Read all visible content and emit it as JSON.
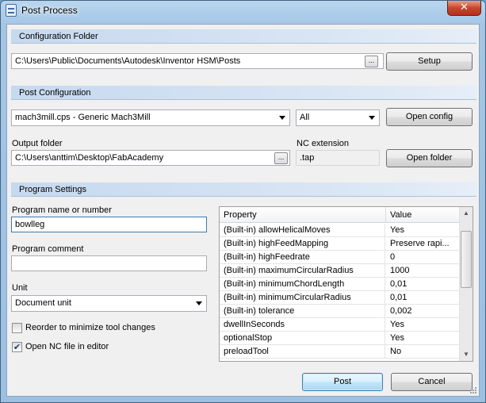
{
  "window": {
    "title": "Post Process",
    "close_symbol": "✕"
  },
  "config_folder": {
    "header": "Configuration Folder",
    "path": "C:\\Users\\Public\\Documents\\Autodesk\\Inventor HSM\\Posts",
    "browse_label": "...",
    "setup_label": "Setup"
  },
  "post_config": {
    "header": "Post Configuration",
    "post_selected": "mach3mill.cps - Generic Mach3Mill",
    "filter_selected": "All",
    "open_config_label": "Open config",
    "output_folder_label": "Output folder",
    "output_folder_path": "C:\\Users\\anttim\\Desktop\\FabAcademy",
    "browse_label": "...",
    "nc_extension_label": "NC extension",
    "nc_extension_value": ".tap",
    "open_folder_label": "Open folder"
  },
  "program_settings": {
    "header": "Program Settings",
    "program_name_label": "Program name or number",
    "program_name_value": "bowlleg",
    "program_comment_label": "Program comment",
    "program_comment_value": "",
    "unit_label": "Unit",
    "unit_selected": "Document unit",
    "reorder_label": "Reorder to minimize tool changes",
    "reorder_checked": false,
    "open_nc_label": "Open NC file in editor",
    "open_nc_checked": true,
    "check_symbol": "✔"
  },
  "properties": {
    "columns": [
      "Property",
      "Value"
    ],
    "rows": [
      {
        "property": "(Built-in) allowHelicalMoves",
        "value": "Yes"
      },
      {
        "property": "(Built-in) highFeedMapping",
        "value": "Preserve rapi..."
      },
      {
        "property": "(Built-in) highFeedrate",
        "value": "0"
      },
      {
        "property": "(Built-in) maximumCircularRadius",
        "value": "1000"
      },
      {
        "property": "(Built-in) minimumChordLength",
        "value": "0,01"
      },
      {
        "property": "(Built-in) minimumCircularRadius",
        "value": "0,01"
      },
      {
        "property": "(Built-in) tolerance",
        "value": "0,002"
      },
      {
        "property": "dwellInSeconds",
        "value": "Yes"
      },
      {
        "property": "optionalStop",
        "value": "Yes"
      },
      {
        "property": "preloadTool",
        "value": "No"
      }
    ]
  },
  "footer": {
    "post_label": "Post",
    "cancel_label": "Cancel"
  }
}
